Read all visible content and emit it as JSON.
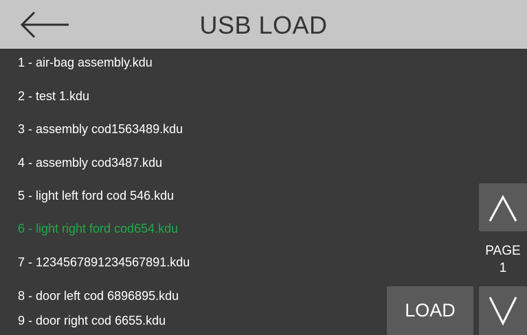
{
  "header": {
    "title": "USB LOAD",
    "back_icon": "arrow-left-icon"
  },
  "files": [
    "1 - air-bag assembly.kdu",
    "2 - test 1.kdu",
    "3 - assembly cod1563489.kdu",
    "4 - assembly cod3487.kdu",
    "5 - light left ford cod 546.kdu",
    "6 - light right ford cod654.kdu",
    "7 - 1234567891234567891.kdu",
    "8 - door left cod 6896895.kdu",
    "9 - door right cod 6655.kdu"
  ],
  "selected_index": 5,
  "pager": {
    "label": "PAGE",
    "number": "1",
    "up_icon": "chevron-up-icon",
    "down_icon": "chevron-down-icon"
  },
  "actions": {
    "load_label": "LOAD"
  },
  "colors": {
    "header_bg": "#c6c6c6",
    "body_bg": "#3a3a3a",
    "button_bg": "#5a5a5a",
    "selected_text": "#22a84a",
    "text": "#ffffff"
  }
}
